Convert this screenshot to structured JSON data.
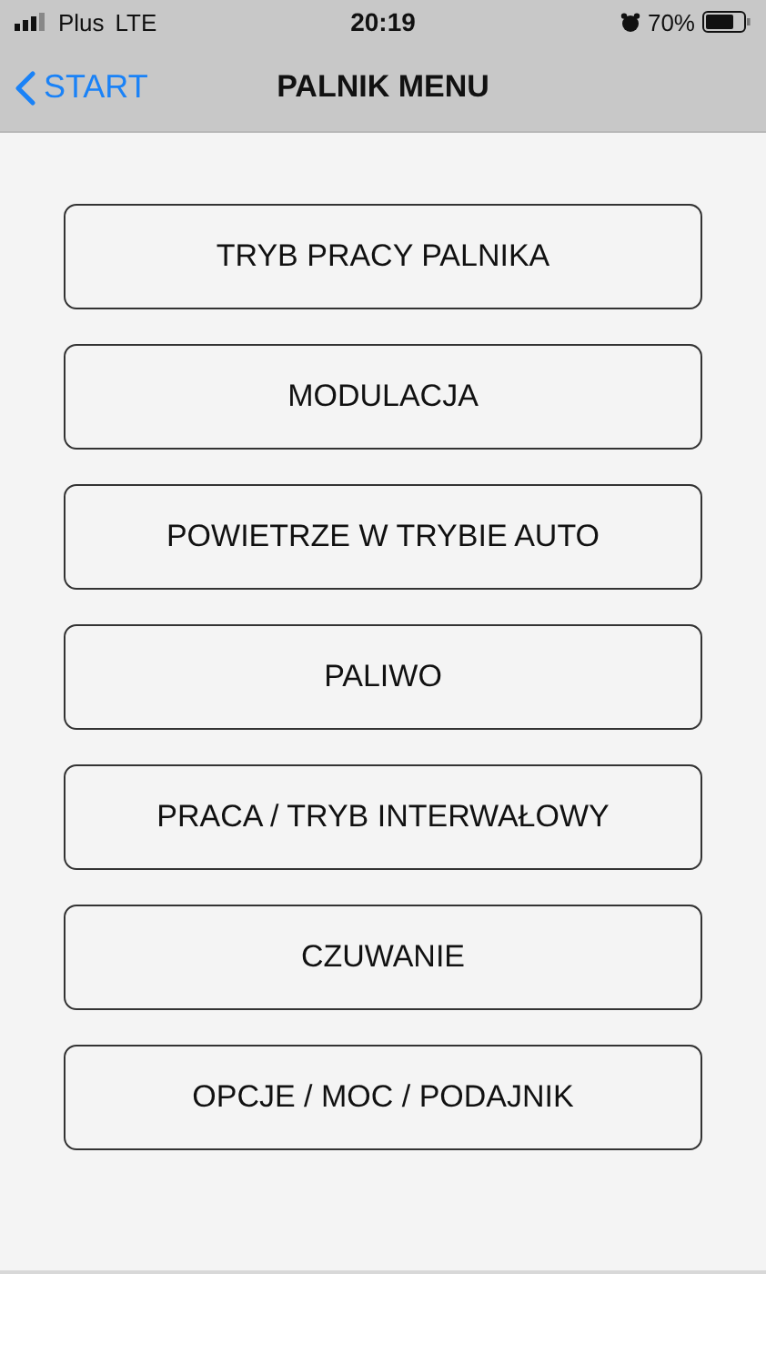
{
  "status_bar": {
    "carrier": "Plus",
    "network": "LTE",
    "time": "20:19",
    "battery": "70%"
  },
  "nav_bar": {
    "back": "START",
    "title": "PALNIK MENU"
  },
  "menu": [
    "TRYB PRACY PALNIKA",
    "MODULACJA",
    "POWIETRZE W TRYBIE AUTO",
    "PALIWO",
    "PRACA / TRYB INTERWAŁOWY",
    "CZUWANIE",
    "OPCJE / MOC / PODAJNIK"
  ]
}
